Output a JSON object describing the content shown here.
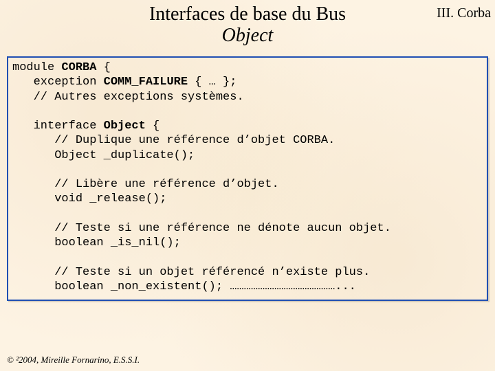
{
  "header": {
    "title_line1": "Interfaces de base du Bus",
    "title_line2": "Object",
    "section": "III. Corba"
  },
  "code": {
    "l1a": "module ",
    "l1b": "CORBA",
    "l1c": " {",
    "l2a": "   exception ",
    "l2b": "COMM_FAILURE",
    "l2c": " { … };",
    "l3": "   // Autres exceptions systèmes.",
    "blank1": " ",
    "l4a": "   interface",
    "l4b": " Object",
    "l4c": " {",
    "l5": "      // Duplique une référence d’objet CORBA.",
    "l6": "      Object _duplicate();",
    "blank2": " ",
    "l7": "      // Libère une référence d’objet.",
    "l8": "      void _release();",
    "blank3": " ",
    "l9": "      // Teste si une référence ne dénote aucun objet.",
    "l10": "      boolean _is_nil();",
    "blank4": " ",
    "l11": "      // Teste si un objet référencé n’existe plus.",
    "l12": "      boolean _non_existent(); ………………………………………..."
  },
  "footer": {
    "text": "© ²2004, Mireille Fornarino, E.S.S.I."
  }
}
